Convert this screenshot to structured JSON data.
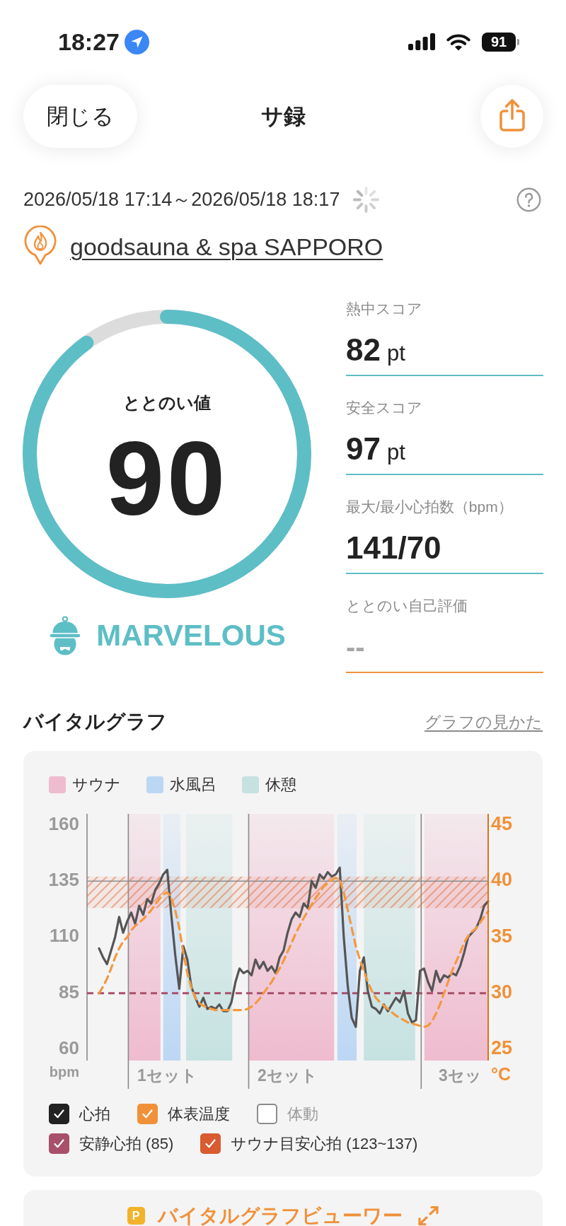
{
  "status_bar": {
    "time": "18:27",
    "battery": "91"
  },
  "nav": {
    "close_button": "閉じる",
    "title": "サ録"
  },
  "session": {
    "period": "2026/05/18 17:14～2026/05/18 18:17",
    "loading": true,
    "facility": "goodsauna & spa SAPPORO"
  },
  "score": {
    "label": "ととのい値",
    "value": "90",
    "level": 0.9,
    "rating": "MARVELOUS"
  },
  "stats": [
    {
      "kind": "stat",
      "label": "熱中スコア",
      "value": "82",
      "unit": "pt"
    },
    {
      "kind": "stat",
      "label": "安全スコア",
      "value": "97",
      "unit": "pt"
    },
    {
      "kind": "stat",
      "label": "最大/最小心拍数（bpm）",
      "value": "141/70"
    },
    {
      "kind": "input",
      "label": "ととのい自己評価",
      "placeholder": "--"
    }
  ],
  "vital_graph": {
    "title": "バイタルグラフ",
    "help_link": "グラフの見かた",
    "legend": [
      {
        "label": "サウナ",
        "color": "#efbbcf"
      },
      {
        "label": "水風呂",
        "color": "#bcd7f4"
      },
      {
        "label": "休憩",
        "color": "#c5e2e1"
      }
    ],
    "chart_data": {
      "type": "line",
      "ylabel": "bpm",
      "y2label": "°C",
      "categories": [
        null,
        null,
        null,
        null,
        null,
        null,
        null,
        null,
        null,
        null,
        null,
        null,
        null,
        null,
        null,
        null,
        null,
        null,
        null,
        null,
        "1セット",
        null,
        null,
        null,
        null,
        null,
        null,
        null,
        null,
        null,
        null,
        null,
        null,
        null,
        null,
        null,
        null,
        null,
        null,
        null,
        null,
        null,
        null,
        null,
        null,
        null,
        null,
        null,
        null,
        null,
        "2セット",
        null,
        null,
        null,
        null,
        null,
        null,
        null,
        null,
        null,
        null,
        null,
        null,
        null,
        null,
        null,
        null,
        null,
        null,
        null,
        null,
        null,
        null,
        null,
        null,
        null,
        null,
        null,
        null,
        null,
        null,
        null,
        null,
        null,
        null,
        null,
        null,
        null,
        null,
        null,
        null,
        null,
        null,
        "3セッ",
        null,
        null,
        null,
        null,
        null,
        null,
        null
      ],
      "ylim": [
        55,
        165
      ],
      "y2lim": [
        24,
        46
      ],
      "yticks": [
        60,
        85,
        110,
        135,
        160
      ],
      "y2ticks": [
        25,
        30,
        35,
        40,
        45
      ],
      "series": [
        {
          "color": "#555555",
          "values": [
            null,
            null,
            null,
            105,
            101,
            98,
            104,
            110,
            119,
            112,
            117,
            121,
            116,
            124,
            120,
            127,
            125,
            131,
            134,
            138,
            140,
            120,
            102,
            87,
            106,
            100,
            88,
            83,
            79,
            83,
            78,
            79,
            78,
            80,
            77,
            77,
            81,
            90,
            96,
            94,
            95,
            93,
            100,
            96,
            99,
            95,
            97,
            94,
            101,
            104,
            112,
            118,
            121,
            119,
            125,
            123,
            135,
            132,
            138,
            136,
            139,
            137,
            138,
            141,
            110,
            88,
            74,
            70,
            95,
            101,
            86,
            79,
            78,
            76,
            80,
            77,
            80,
            83,
            81,
            86,
            76,
            72,
            73,
            95,
            96,
            90,
            86,
            95,
            90,
            93,
            92,
            94,
            93,
            97,
            103,
            110,
            112,
            114,
            118,
            124,
            126
          ]
        },
        {
          "color": "#f3993f",
          "axis": "y2",
          "line_style": "dashed",
          "values": [
            null,
            null,
            null,
            30.0,
            30.6,
            31.3,
            32.2,
            33.2,
            34.0,
            34.6,
            35.0,
            35.6,
            36.0,
            36.3,
            36.6,
            37.0,
            37.4,
            37.9,
            38.4,
            38.8,
            39.0,
            38.5,
            37.4,
            35.8,
            33.6,
            31.8,
            30.5,
            29.6,
            29.1,
            28.9,
            28.7,
            28.6,
            28.5,
            28.5,
            28.5,
            28.5,
            28.5,
            28.5,
            28.5,
            28.5,
            28.6,
            28.8,
            29.1,
            29.5,
            30.0,
            30.5,
            31.0,
            31.6,
            32.2,
            32.9,
            33.7,
            34.5,
            35.3,
            36.0,
            36.7,
            37.3,
            37.9,
            38.5,
            39.0,
            39.5,
            39.8,
            40.1,
            40.3,
            40.1,
            39.0,
            37.4,
            35.8,
            34.2,
            33.0,
            32.0,
            31.0,
            30.2,
            29.6,
            29.2,
            28.9,
            28.6,
            28.3,
            28.0,
            27.8,
            27.6,
            27.4,
            27.3,
            27.2,
            27.1,
            27.0,
            27.1,
            27.5,
            28.2,
            29.0,
            30.0,
            31.0,
            32.0,
            32.8,
            33.6,
            34.5,
            35.1,
            35.5,
            35.8,
            36.3,
            36.8,
            37.3
          ]
        }
      ],
      "bands": [
        {
          "axis": "y",
          "from": 123,
          "to": 137,
          "color": "#e2774c"
        }
      ],
      "ref_lines": [
        {
          "axis": "y",
          "value": 135,
          "color": "#8c8c8c"
        },
        {
          "axis": "y",
          "value": 85,
          "color": "#a8506a"
        }
      ]
    },
    "series_toggles": [
      {
        "label": "心拍",
        "checked": true,
        "color": "#222222"
      },
      {
        "label": "体表温度",
        "checked": true,
        "color": "#f0913a"
      },
      {
        "label": "体動",
        "checked": false,
        "color": "#8c8c8c"
      }
    ],
    "reference_toggles": [
      {
        "label": "安静心拍 (85)",
        "checked": true,
        "color": "#a8506a"
      },
      {
        "label": "サウナ目安心拍 (123~137)",
        "checked": true,
        "color": "#d95b30"
      }
    ]
  },
  "viewer_button": {
    "badge": "P",
    "label": "バイタルグラフビューワー"
  }
}
